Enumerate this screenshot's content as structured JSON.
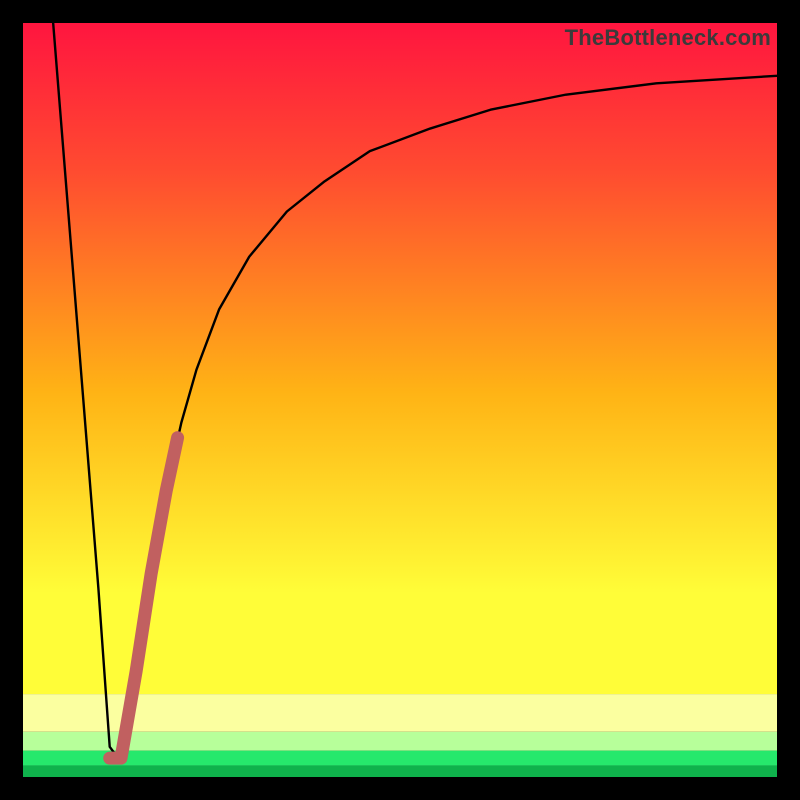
{
  "watermark": "TheBottleneck.com",
  "colors": {
    "frame": "#000000",
    "curve": "#000000",
    "segment": "#c16060",
    "base_green": "#12e85b",
    "gradient_top": "#ff153f",
    "gradient_upper": "#ff4b30",
    "gradient_mid": "#ffb315",
    "gradient_yellow": "#fffd38",
    "gradient_pale": "#fbffa0",
    "gradient_lightgreen": "#b7ff9a",
    "gradient_green": "#26e86c",
    "gradient_deepgreen": "#0fb24c"
  },
  "chart_data": {
    "type": "line",
    "title": "",
    "xlabel": "",
    "ylabel": "",
    "xlim": [
      0,
      100
    ],
    "ylim": [
      0,
      100
    ],
    "series": [
      {
        "name": "bottleneck-curve",
        "x": [
          4,
          6,
          8,
          10,
          11.5,
          13,
          15,
          17,
          19,
          21,
          23,
          26,
          30,
          35,
          40,
          46,
          54,
          62,
          72,
          84,
          100
        ],
        "y": [
          100,
          75,
          50,
          25,
          4,
          2,
          14,
          27,
          38,
          47,
          54,
          62,
          69,
          75,
          79,
          83,
          86,
          88.5,
          90.5,
          92,
          93
        ]
      },
      {
        "name": "highlight-segment",
        "x": [
          11.5,
          13,
          15,
          17,
          19,
          20.5
        ],
        "y": [
          2.5,
          2.5,
          14,
          27,
          38,
          45
        ]
      }
    ],
    "background_bands": [
      {
        "y0": 0,
        "y1": 1.5,
        "color": "gradient_deepgreen"
      },
      {
        "y0": 1.5,
        "y1": 3.5,
        "color": "gradient_green"
      },
      {
        "y0": 3.5,
        "y1": 6,
        "color": "gradient_lightgreen"
      },
      {
        "y0": 6,
        "y1": 11,
        "color": "gradient_pale"
      },
      {
        "y0": 11,
        "y1": 100,
        "color": "vertical_gradient"
      }
    ]
  }
}
